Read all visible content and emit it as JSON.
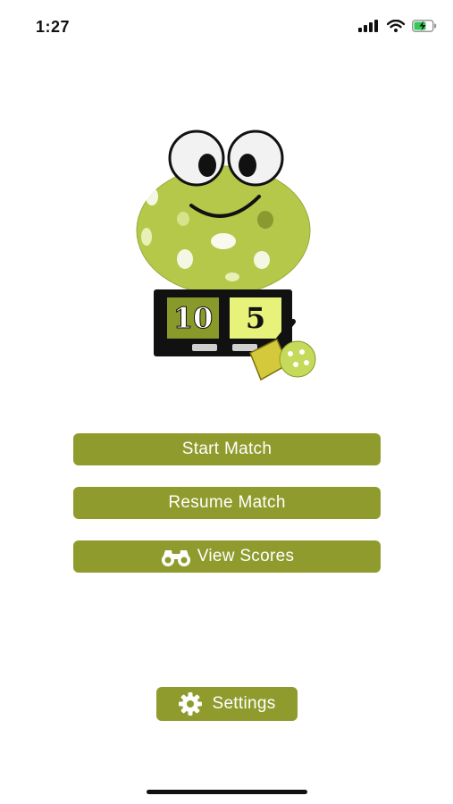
{
  "status_bar": {
    "time": "1:27",
    "icons": [
      "cellular-signal-icon",
      "wifi-icon",
      "battery-charging-icon"
    ]
  },
  "logo": {
    "score_left": "10",
    "score_right": "5"
  },
  "menu": {
    "start_label": "Start Match",
    "resume_label": "Resume Match",
    "view_label": "View Scores",
    "settings_label": "Settings"
  },
  "colors": {
    "button_bg": "#8f9c2d",
    "button_text": "#ffffff",
    "ball_green": "#b5c84a"
  }
}
